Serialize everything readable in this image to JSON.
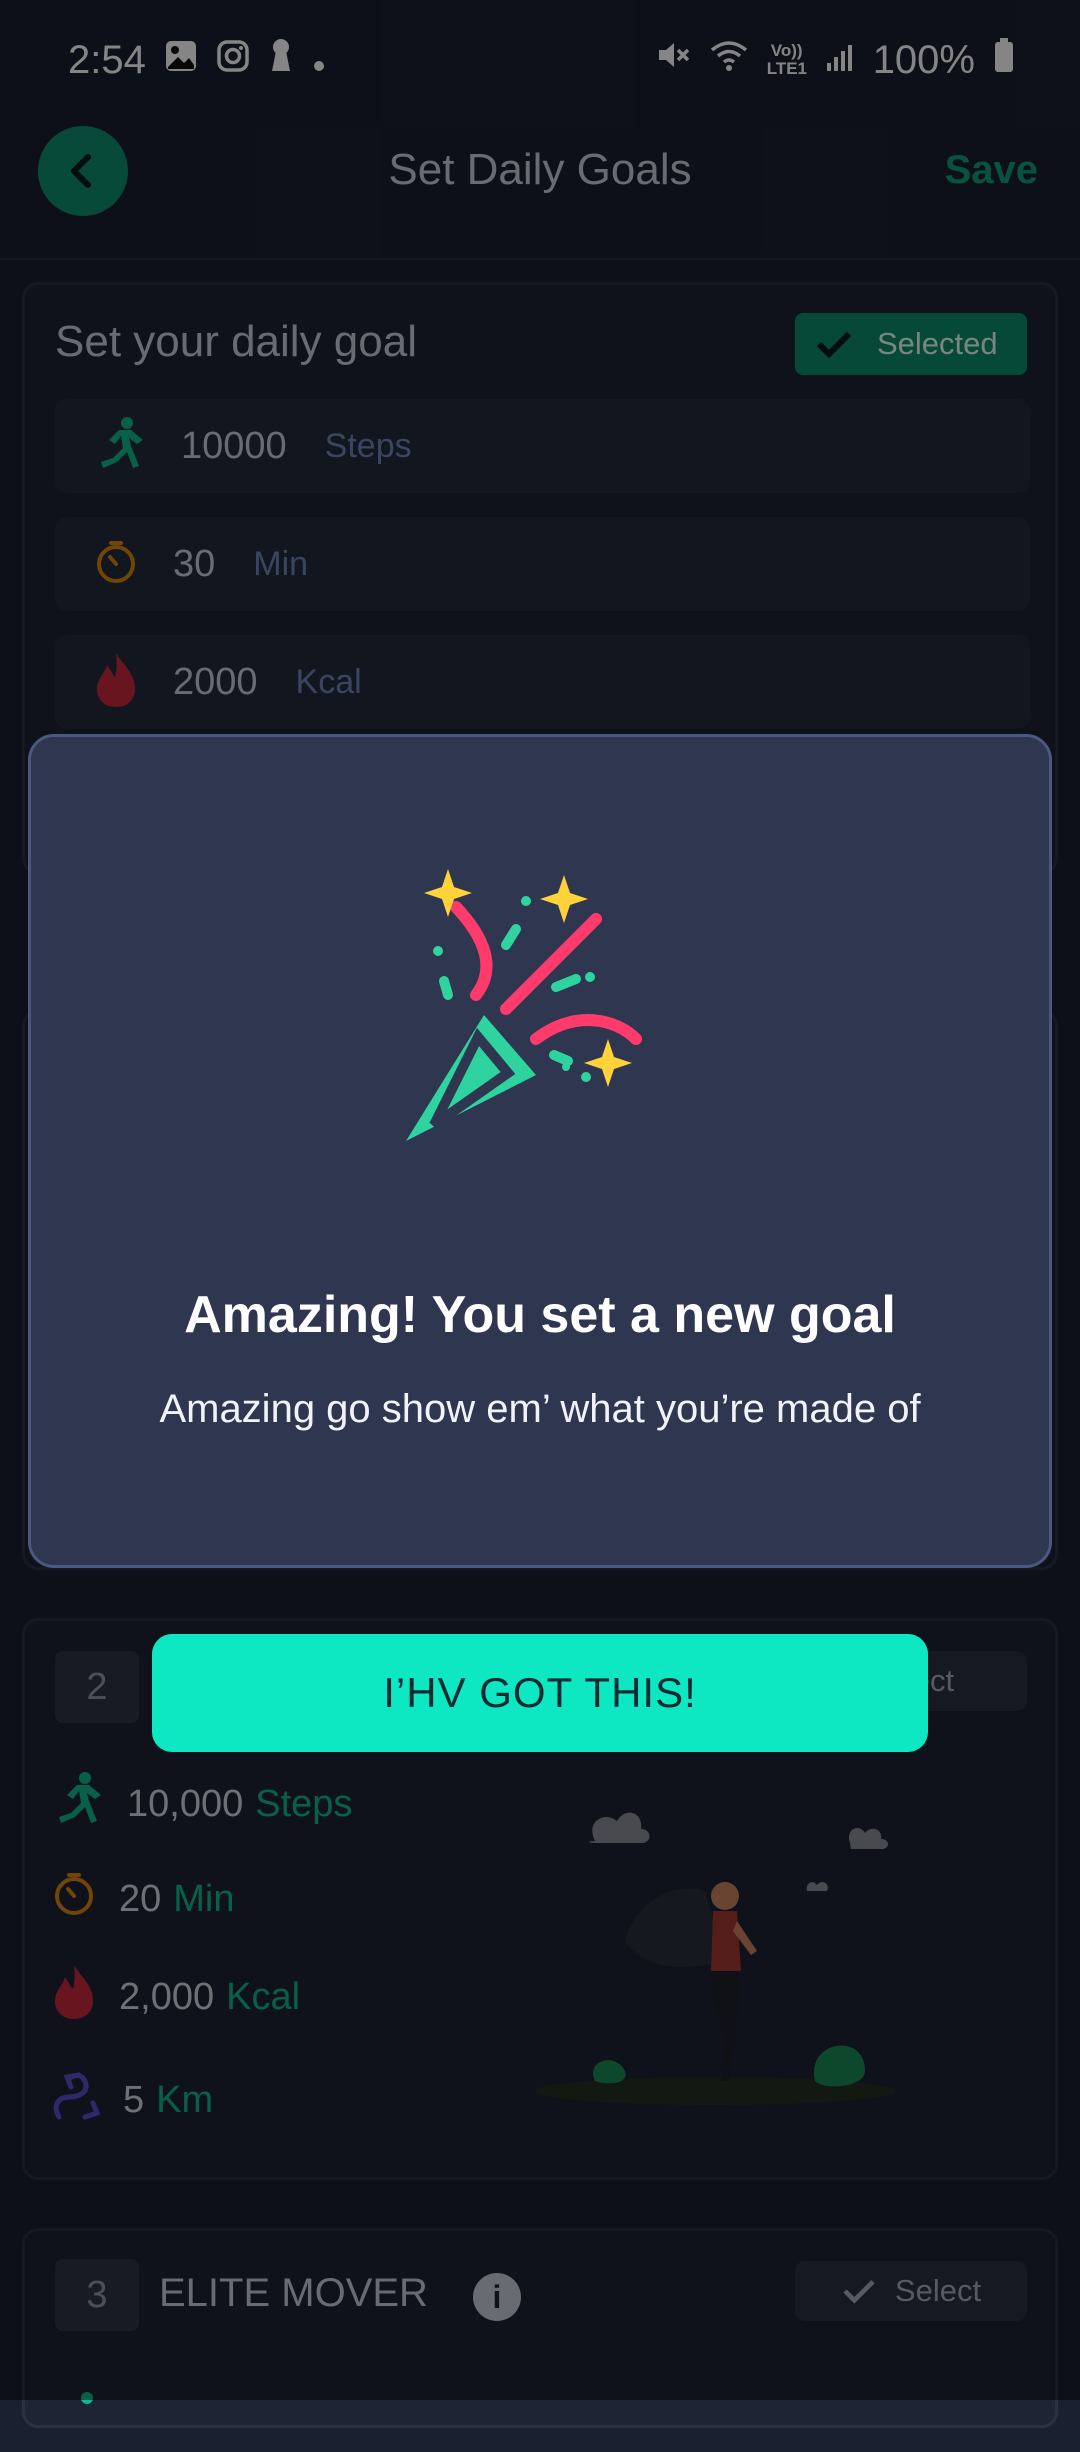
{
  "status_bar": {
    "time": "2:54",
    "battery": "100%",
    "network": "Vo)) LTE1"
  },
  "header": {
    "title": "Set Daily Goals",
    "save_label": "Save"
  },
  "current_goal": {
    "title": "Set your daily goal",
    "badge": "Selected",
    "rows": [
      {
        "value": "10000",
        "unit": "Steps",
        "icon": "running-icon"
      },
      {
        "value": "30",
        "unit": "Min",
        "icon": "timer-icon"
      },
      {
        "value": "2000",
        "unit": "Kcal",
        "icon": "flame-icon"
      }
    ]
  },
  "plan2": {
    "number": "2",
    "select_label": "Select",
    "rows": [
      {
        "value": "10,000",
        "unit": "Steps"
      },
      {
        "value": "20",
        "unit": "Min"
      },
      {
        "value": "2,000",
        "unit": "Kcal"
      },
      {
        "value": "5",
        "unit": "Km"
      }
    ]
  },
  "plan3": {
    "number": "3",
    "name": "ELITE MOVER",
    "select_label": "Select"
  },
  "modal": {
    "title": "Amazing! You set a new goal",
    "message": "Amazing go show em’ what you’re made of",
    "button_label": "I’HV GOT THIS!",
    "illustration": "party-popper-icon"
  },
  "colors": {
    "accent": "#0de8c2",
    "brand_green": "#0f8f6e",
    "modal_bg": "#2f3650"
  }
}
